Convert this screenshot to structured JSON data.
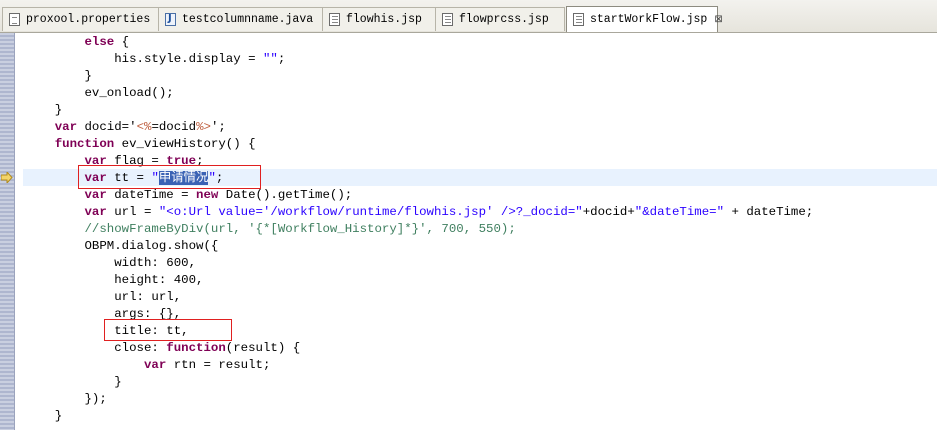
{
  "tabs": [
    {
      "label": "proxool.properties",
      "icon": "properties-file-icon"
    },
    {
      "label": "testcolumnname.java",
      "icon": "java-file-icon"
    },
    {
      "label": "flowhis.jsp",
      "icon": "jsp-file-icon"
    },
    {
      "label": "flowprcss.jsp",
      "icon": "jsp-file-icon"
    },
    {
      "label": "startWorkFlow.jsp",
      "icon": "jsp-file-icon",
      "active": true,
      "close": "⊠"
    }
  ],
  "code": {
    "l1": {
      "kw": "else",
      "rest": " {"
    },
    "l2": {
      "a": "his.style.display = ",
      "str": "\"\"",
      "b": ";"
    },
    "l3": "}",
    "l4": "ev_onload();",
    "l5": "}",
    "l6": {
      "kw": "var",
      "a": " docid='",
      "t1": "<%",
      "b": "=docid",
      "t2": "%>",
      "c": "';"
    },
    "l7": {
      "kw": "function",
      "a": " ev_viewHistory() {"
    },
    "l8": {
      "kw1": "var",
      "a": " flag = ",
      "kw2": "true",
      "b": ";"
    },
    "l9": {
      "kw": "var",
      "a": " tt = ",
      "q1": "\"",
      "sel": "申请情况",
      "q2": "\"",
      "b": ";"
    },
    "l10": {
      "kw1": "var",
      "a": " dateTime = ",
      "kw2": "new",
      "b": " Date().getTime();"
    },
    "l11": {
      "kw": "var",
      "a": " url = ",
      "s1": "\"<o:Url value='/workflow/runtime/flowhis.jsp' />?_docid=\"",
      "b": "+docid+",
      "s2": "\"&dateTime=\"",
      "c": " + dateTime;"
    },
    "l12": "//showFrameByDiv(url, '{*[Workflow_History]*}', 700, 550);",
    "l13": "OBPM.dialog.show({",
    "l14": "width: 600,",
    "l15": "height: 400,",
    "l16": "url: url,",
    "l17": "args: {},",
    "l18": "title: tt,",
    "l19": {
      "a": "close: ",
      "kw": "function",
      "b": "(result) {"
    },
    "l20": {
      "kw": "var",
      "a": " rtn = result;"
    },
    "l21": "}",
    "l22": "});",
    "l23": "}"
  },
  "colors": {
    "keyword": "#7f0055",
    "string": "#2a00ff",
    "comment": "#3f7f5f",
    "jsp_tag": "#bf5f3f",
    "selection": "#3a62b4",
    "highlight_box": "#e02020",
    "current_line": "#e8f2fe"
  }
}
